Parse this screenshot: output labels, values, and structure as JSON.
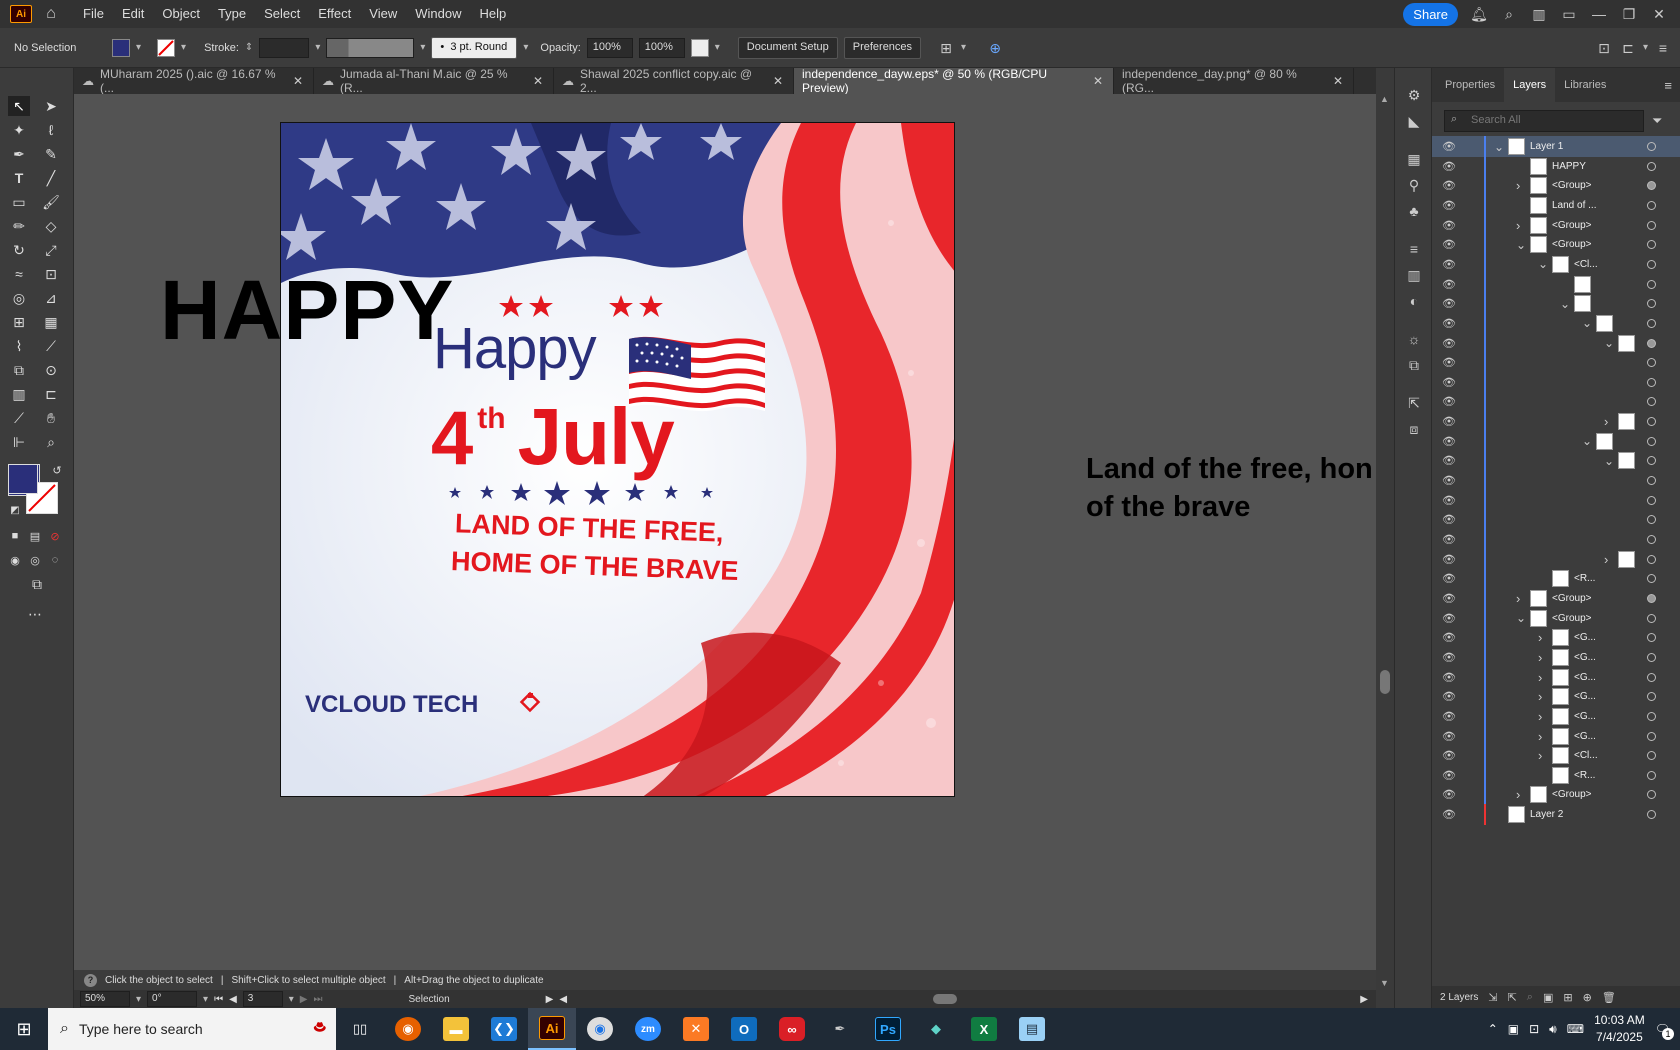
{
  "menu": {
    "logo": "Ai",
    "items": [
      "File",
      "Edit",
      "Object",
      "Type",
      "Select",
      "Effect",
      "View",
      "Window",
      "Help"
    ],
    "share": "Share"
  },
  "control": {
    "selection": "No Selection",
    "stroke_label": "Stroke:",
    "brush": "3 pt. Round",
    "opacity_label": "Opacity:",
    "opacity_value": "100%",
    "opacity_value2": "100%",
    "doc_setup": "Document Setup",
    "preferences": "Preferences"
  },
  "tabs": [
    {
      "label": "MUharam 2025 ().aic @ 16.67 % (..."
    },
    {
      "label": "Jumada al-Thani M.aic @ 25 % (R..."
    },
    {
      "label": "Shawal 2025 conflict copy.aic @ 2..."
    },
    {
      "label": "independence_dayw.eps* @ 50 % (RGB/CPU Preview)"
    },
    {
      "label": "independence_day.png* @ 80 % (RG..."
    }
  ],
  "canvas": {
    "happy_outside": "HAPPY",
    "side_text_1": "Land of the free, hon",
    "side_text_2": "of the brave"
  },
  "artwork": {
    "happy": "Happy",
    "fourth": "4",
    "th": "th",
    "july": "July",
    "line1": "LAND OF THE FREE,",
    "line2": "HOME OF THE BRAVE",
    "brand_v": "V",
    "brand_rest": "CLOUD TECH",
    "colors": {
      "red": "#e3171e",
      "navy": "#2a2f7a",
      "flag_blue": "#3a3f8f"
    }
  },
  "colors": {
    "fill": "#2a2f7a",
    "accent": "#1473e6"
  },
  "panel": {
    "tabs": [
      "Properties",
      "Layers",
      "Libraries"
    ],
    "search_placeholder": "Search All",
    "layers": [
      {
        "name": "Layer 1",
        "indent": 0,
        "chev": "v",
        "selected": true
      },
      {
        "name": "HAPPY",
        "indent": 1,
        "chev": ""
      },
      {
        "name": "<Group>",
        "indent": 1,
        "chev": ">",
        "filled": true
      },
      {
        "name": "Land of ...",
        "indent": 1,
        "chev": ""
      },
      {
        "name": "<Group>",
        "indent": 1,
        "chev": ">"
      },
      {
        "name": "<Group>",
        "indent": 1,
        "chev": "v"
      },
      {
        "name": "<Cl...",
        "indent": 2,
        "chev": "v"
      },
      {
        "name": "",
        "indent": 3,
        "chev": ""
      },
      {
        "name": "",
        "indent": 3,
        "chev": "v"
      },
      {
        "name": "",
        "indent": 4,
        "chev": "v"
      },
      {
        "name": "",
        "indent": 5,
        "chev": "v",
        "filled": true
      },
      {
        "name": "",
        "indent": 6,
        "chev": "",
        "nothumb": true
      },
      {
        "name": "",
        "indent": 6,
        "chev": "",
        "nothumb": true
      },
      {
        "name": "",
        "indent": 6,
        "chev": "",
        "nothumb": true
      },
      {
        "name": "",
        "indent": 5,
        "chev": ">"
      },
      {
        "name": "",
        "indent": 4,
        "chev": "v"
      },
      {
        "name": "",
        "indent": 5,
        "chev": "v"
      },
      {
        "name": "",
        "indent": 6,
        "chev": "",
        "nothumb": true
      },
      {
        "name": "",
        "indent": 6,
        "chev": "",
        "nothumb": true
      },
      {
        "name": "",
        "indent": 6,
        "chev": "",
        "nothumb": true
      },
      {
        "name": "",
        "indent": 6,
        "chev": "",
        "nothumb": true
      },
      {
        "name": "",
        "indent": 5,
        "chev": ">"
      },
      {
        "name": "<R...",
        "indent": 2,
        "chev": ""
      },
      {
        "name": "<Group>",
        "indent": 1,
        "chev": ">",
        "filled": true
      },
      {
        "name": "<Group>",
        "indent": 1,
        "chev": "v"
      },
      {
        "name": "<G...",
        "indent": 2,
        "chev": ">"
      },
      {
        "name": "<G...",
        "indent": 2,
        "chev": ">"
      },
      {
        "name": "<G...",
        "indent": 2,
        "chev": ">"
      },
      {
        "name": "<G...",
        "indent": 2,
        "chev": ">"
      },
      {
        "name": "<G...",
        "indent": 2,
        "chev": ">"
      },
      {
        "name": "<G...",
        "indent": 2,
        "chev": ">"
      },
      {
        "name": "<Cl...",
        "indent": 2,
        "chev": ">"
      },
      {
        "name": "<R...",
        "indent": 2,
        "chev": ""
      },
      {
        "name": "<Group>",
        "indent": 1,
        "chev": ">"
      },
      {
        "name": "Layer 2",
        "indent": 0,
        "chev": "",
        "red": true
      }
    ],
    "footer": "2 Layers"
  },
  "status": {
    "hint_1": "Click the object to select",
    "hint_2": "Shift+Click to select multiple object",
    "hint_3": "Alt+Drag the object to duplicate",
    "zoom": "50%",
    "rotation": "0°",
    "artboard": "3",
    "tool": "Selection"
  },
  "taskbar": {
    "search": "Type here to search",
    "time": "10:03 AM",
    "date": "7/4/2025",
    "notif": "1"
  }
}
